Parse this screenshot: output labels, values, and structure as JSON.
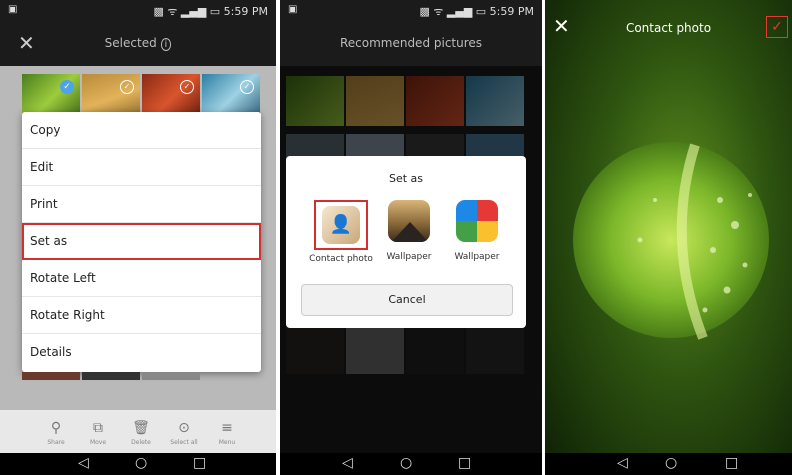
{
  "panel1": {
    "status_time": "5:59 PM",
    "top_title": "Selected",
    "menu": [
      "Copy",
      "Edit",
      "Print",
      "Set as",
      "Rotate Left",
      "Rotate Right",
      "Details"
    ],
    "bottom_actions": [
      {
        "icon": "share-icon",
        "label": "Share"
      },
      {
        "icon": "move-icon",
        "label": "Move"
      },
      {
        "icon": "delete-icon",
        "label": "Delete"
      },
      {
        "icon": "select-all-icon",
        "label": "Select all"
      },
      {
        "icon": "menu-icon",
        "label": "Menu"
      }
    ]
  },
  "panel2": {
    "status_time": "5:59 PM",
    "top_title": "Recommended pictures",
    "dialog_title": "Set as",
    "options": [
      {
        "icon": "contact-photo-icon",
        "label": "Contact photo"
      },
      {
        "icon": "wallpaper-icon",
        "label": "Wallpaper"
      },
      {
        "icon": "wallpaper-pinwheel-icon",
        "label": "Wallpaper"
      }
    ],
    "cancel_label": "Cancel"
  },
  "panel3": {
    "title": "Contact photo"
  },
  "colors": {
    "highlight": "#d32f2f",
    "accent": "#8bc34a"
  }
}
